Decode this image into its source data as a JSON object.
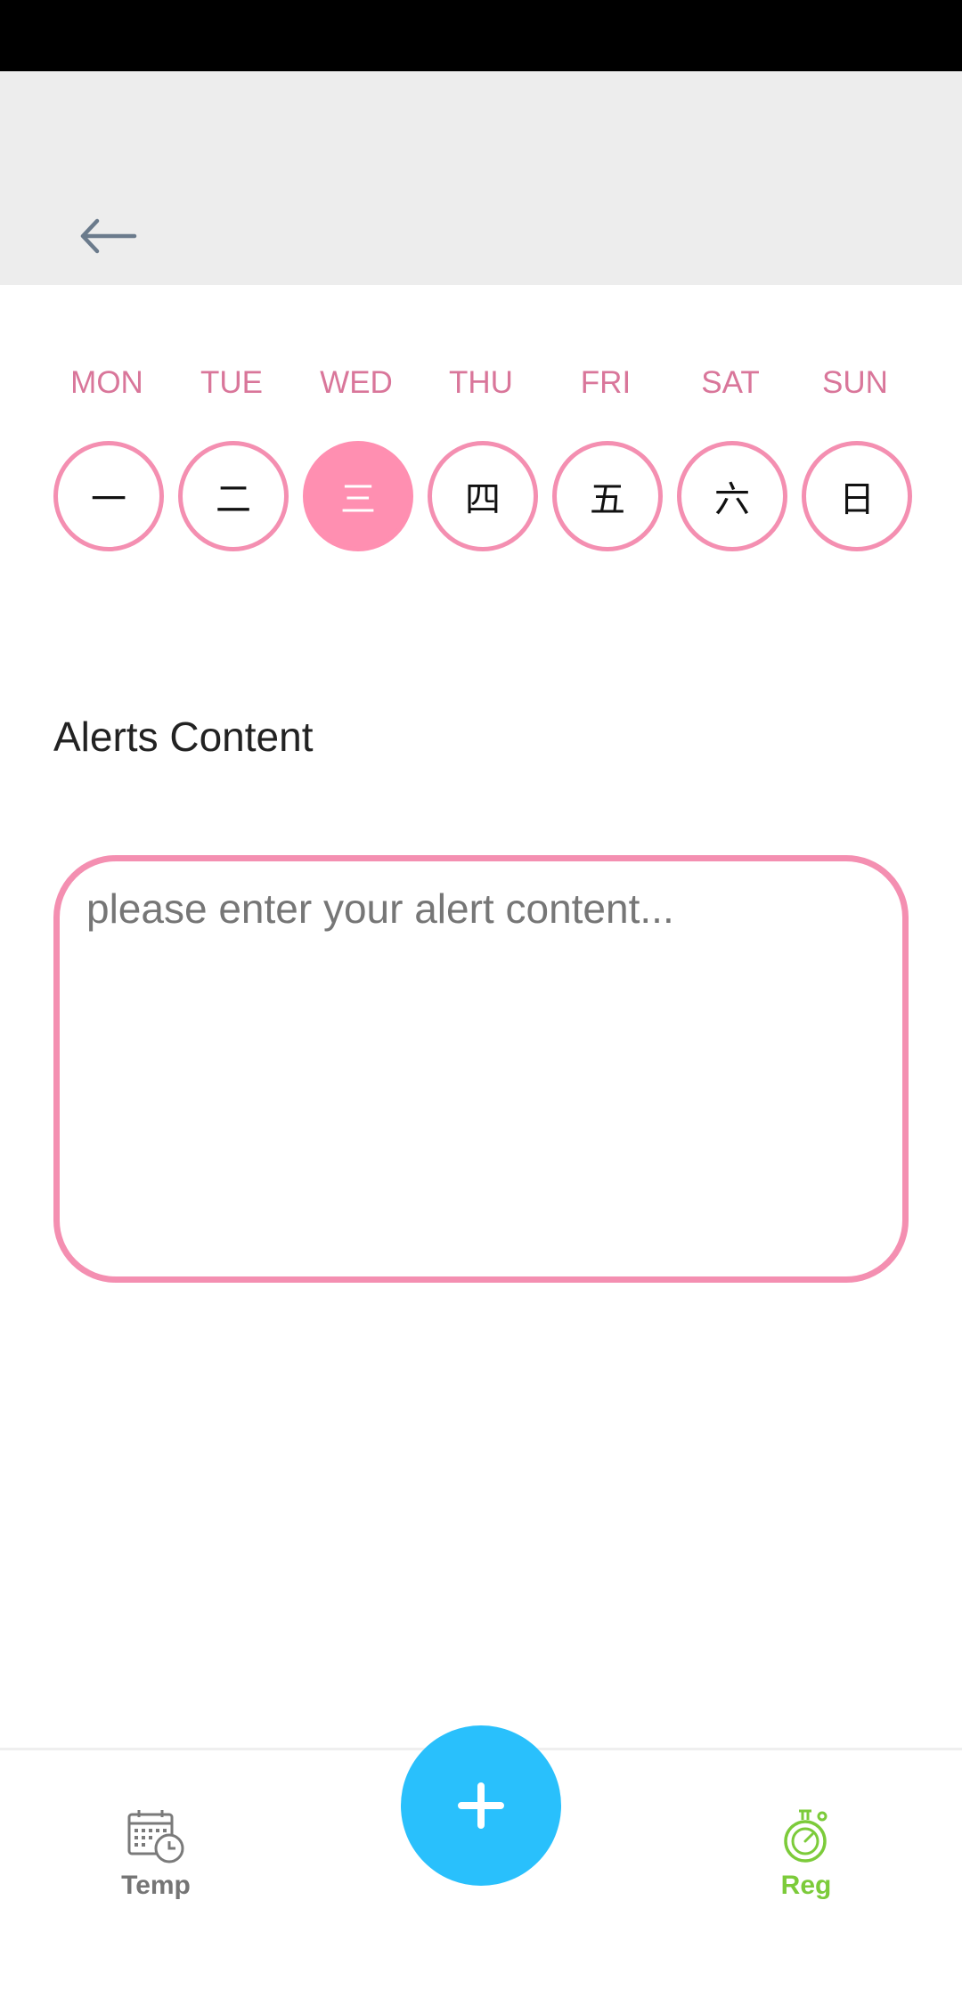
{
  "header": {
    "back_icon": "arrow-left-icon"
  },
  "weekdays": [
    {
      "label": "MON",
      "char": "一",
      "selected": false
    },
    {
      "label": "TUE",
      "char": "二",
      "selected": false
    },
    {
      "label": "WED",
      "char": "三",
      "selected": true
    },
    {
      "label": "THU",
      "char": "四",
      "selected": false
    },
    {
      "label": "FRI",
      "char": "五",
      "selected": false
    },
    {
      "label": "SAT",
      "char": "六",
      "selected": false
    },
    {
      "label": "SUN",
      "char": "日",
      "selected": false
    }
  ],
  "alerts": {
    "title": "Alerts Content",
    "value": "",
    "placeholder": "please enter your alert content..."
  },
  "bottom_nav": {
    "temp": {
      "label": "Temp",
      "icon": "calendar-clock-icon",
      "color": "#757575"
    },
    "add": {
      "icon": "plus-icon",
      "color": "#29c0fc"
    },
    "reg": {
      "label": "Reg",
      "icon": "stopwatch-icon",
      "color": "#7ccb3a"
    }
  },
  "colors": {
    "accent_pink": "#f48fb1",
    "selected_pink": "#ff8fb1",
    "weekday_text": "#d9769a",
    "header_bg": "#ededed",
    "fab_blue": "#29c0fc",
    "active_green": "#7ccb3a"
  }
}
